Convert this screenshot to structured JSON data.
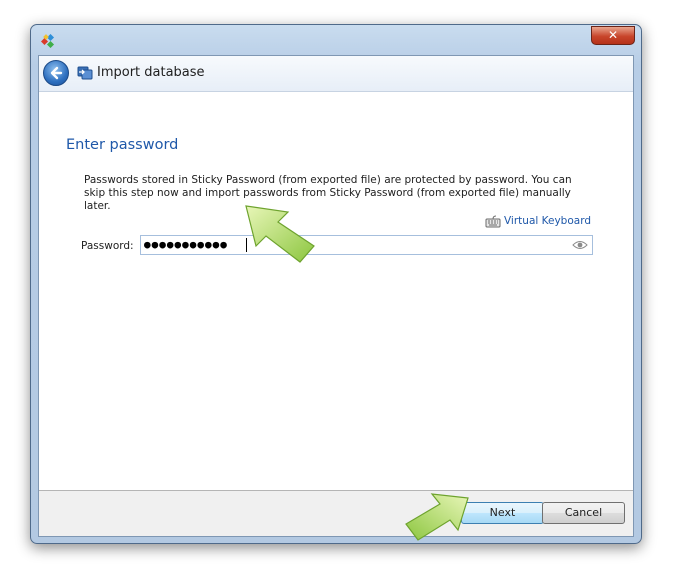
{
  "window": {
    "title_bar_close": "✕",
    "header_title": "Import database"
  },
  "content": {
    "title": "Enter password",
    "description": "Passwords stored in Sticky Password (from exported file) are protected by password. You can skip this step now and import passwords from Sticky Password (from exported file) manually later.",
    "virtual_keyboard_label": "Virtual Keyboard",
    "password_label": "Password:",
    "password_masked": "●●●●●●●●●●●"
  },
  "footer": {
    "next_label": "Next",
    "cancel_label": "Cancel"
  },
  "colors": {
    "accent": "#1f58a9",
    "arrow_green": "#9ccc3f"
  },
  "icons": {
    "app": "sticky-password-app-icon",
    "back": "back-arrow-icon",
    "header": "import-database-icon",
    "keyboard": "keyboard-icon",
    "eye": "eye-icon",
    "close": "close-icon"
  }
}
